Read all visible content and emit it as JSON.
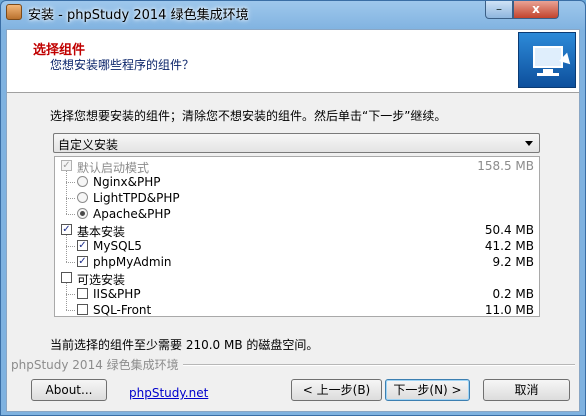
{
  "window": {
    "title": "安装 - phpStudy 2014 绿色集成环境",
    "minimize_glyph": "–",
    "close_glyph": "x"
  },
  "header": {
    "title": "选择组件",
    "subtitle": "您想安装哪些程序的组件？",
    "image_icon": "computer-arrow-icon"
  },
  "instruction": "选择您想要安装的组件；清除您不想安装的组件。然后单击“下一步”继续。",
  "install_type": {
    "selected": "自定义安装"
  },
  "components": [
    {
      "label": "默认启动模式",
      "size": "158.5 MB",
      "kind": "checkbox",
      "checked": true,
      "disabled": true
    },
    {
      "label": "Nginx&PHP",
      "size": "",
      "kind": "radio",
      "checked": false,
      "disabled": false
    },
    {
      "label": "LightTPD&PHP",
      "size": "",
      "kind": "radio",
      "checked": false,
      "disabled": false
    },
    {
      "label": "Apache&PHP",
      "size": "",
      "kind": "radio",
      "checked": true,
      "disabled": false
    },
    {
      "label": "基本安装",
      "size": "50.4 MB",
      "kind": "checkbox",
      "checked": true,
      "disabled": false
    },
    {
      "label": "MySQL5",
      "size": "41.2 MB",
      "kind": "checkbox",
      "checked": true,
      "disabled": false
    },
    {
      "label": "phpMyAdmin",
      "size": "9.2 MB",
      "kind": "checkbox",
      "checked": true,
      "disabled": false
    },
    {
      "label": "可选安装",
      "size": "",
      "kind": "checkbox",
      "checked": false,
      "disabled": false
    },
    {
      "label": "IIS&PHP",
      "size": "0.2 MB",
      "kind": "checkbox",
      "checked": false,
      "disabled": false
    },
    {
      "label": "SQL-Front",
      "size": "11.0 MB",
      "kind": "checkbox",
      "checked": false,
      "disabled": false
    }
  ],
  "space_note": "当前选择的组件至少需要 210.0 MB 的磁盘空间。",
  "branding": "phpStudy 2014 绿色集成环境",
  "footer": {
    "about_label": "About...",
    "link_label": "phpStudy.net",
    "back_label": "< 上一步(B)",
    "next_label": "下一步(N) >",
    "cancel_label": "取消"
  },
  "colors": {
    "header_title": "#c00000",
    "header_subtitle": "#0a246a",
    "link": "#0000cc"
  }
}
